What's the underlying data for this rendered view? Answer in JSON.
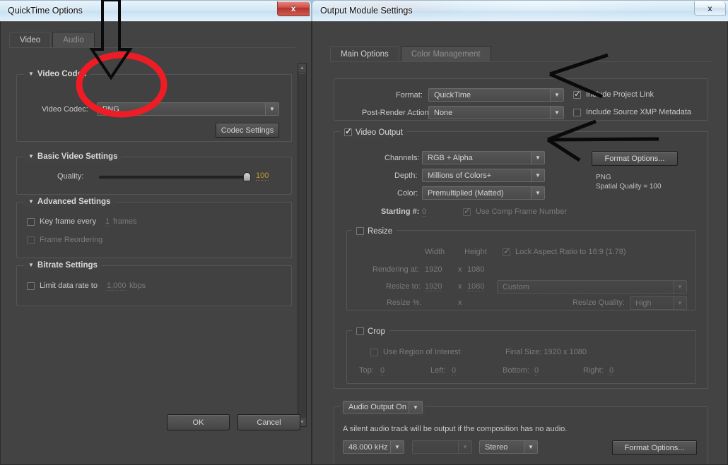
{
  "desktop": {
    "background_hint": "blurred aero desktop"
  },
  "quicktime_dialog": {
    "title": "QuickTime Options",
    "close_icon": "close-icon",
    "close_label": "x",
    "tabs": [
      {
        "label": "Video",
        "active": true
      },
      {
        "label": "Audio",
        "active": false
      }
    ],
    "video_codec": {
      "group_title": "Video Codec",
      "codec_label": "Video Codec:",
      "codec_value": "PNG",
      "codec_settings_button": "Codec Settings"
    },
    "basic_video": {
      "group_title": "Basic Video Settings",
      "quality_label": "Quality:",
      "quality_value": "100"
    },
    "advanced": {
      "group_title": "Advanced Settings",
      "key_frame_label": "Key frame every",
      "key_frame_value": "1",
      "key_frame_unit": "frames",
      "key_frame_checked": false,
      "frame_reordering_label": "Frame Reordering",
      "frame_reordering_checked": false
    },
    "bitrate": {
      "group_title": "Bitrate Settings",
      "limit_label": "Limit data rate to",
      "limit_value": "1,000",
      "limit_unit": "kbps",
      "limit_checked": false
    },
    "footer": {
      "ok_label": "OK",
      "cancel_label": "Cancel"
    }
  },
  "output_module_dialog": {
    "title": "Output Module Settings",
    "close_icon": "close-icon",
    "close_label": "x",
    "tabs": [
      {
        "label": "Main Options",
        "active": true
      },
      {
        "label": "Color Management",
        "active": false
      }
    ],
    "format_section": {
      "format_label": "Format:",
      "format_value": "QuickTime",
      "post_render_label": "Post-Render Action:",
      "post_render_value": "None",
      "include_project_link_label": "Include Project Link",
      "include_project_link_checked": true,
      "include_xmp_label": "Include Source XMP Metadata",
      "include_xmp_checked": false
    },
    "video_output": {
      "group_title": "Video Output",
      "enabled": true,
      "channels_label": "Channels:",
      "channels_value": "RGB + Alpha",
      "depth_label": "Depth:",
      "depth_value": "Millions of Colors+",
      "color_label": "Color:",
      "color_value": "Premultiplied (Matted)",
      "starting_label": "Starting #:",
      "starting_value": "0",
      "use_comp_frame_number_label": "Use Comp Frame Number",
      "use_comp_frame_number_checked": true,
      "format_options_button": "Format Options...",
      "format_info_line1": "PNG",
      "format_info_line2": "Spatial Quality = 100"
    },
    "resize": {
      "group_title": "Resize",
      "enabled": false,
      "width_header": "Width",
      "height_header": "Height",
      "lock_aspect_label": "Lock Aspect Ratio to 16:9 (1.78)",
      "lock_aspect_checked": true,
      "rendering_at_label": "Rendering at:",
      "rendering_width": "1920",
      "rendering_height": "1080",
      "resize_to_label": "Resize to:",
      "resize_width": "1920",
      "resize_height": "1080",
      "resize_preset": "Custom",
      "resize_pct_label": "Resize %:",
      "x_separator": "x",
      "resize_quality_label": "Resize Quality:",
      "resize_quality_value": "High"
    },
    "crop": {
      "group_title": "Crop",
      "enabled": false,
      "use_roi_label": "Use Region of Interest",
      "use_roi_checked": false,
      "final_size_label": "Final Size: 1920 x 1080",
      "top_label": "Top:",
      "top_value": "0",
      "left_label": "Left:",
      "left_value": "0",
      "bottom_label": "Bottom:",
      "bottom_value": "0",
      "right_label": "Right:",
      "right_value": "0"
    },
    "audio": {
      "toggle_value": "Audio Output On",
      "note": "A silent audio track will be output if the composition has no audio.",
      "sample_rate": "48.000 kHz",
      "bit_depth": "",
      "channels": "Stereo",
      "format_options_button": "Format Options..."
    }
  },
  "annotations": {
    "red_ellipse": "red-highlight-ellipse around Video Codec PNG dropdown",
    "arrow_down": "black-down-arrow pointing at Video Codec field",
    "arrow_format": "black-left-arrow pointing at Format dropdown",
    "arrow_channels": "black-left-arrow pointing at Channels dropdown"
  },
  "colors": {
    "accent_orange": "#c89a34",
    "annotation_red": "#ee1c25",
    "annotation_black": "#0a0a0a",
    "panel_bg": "#434343"
  }
}
